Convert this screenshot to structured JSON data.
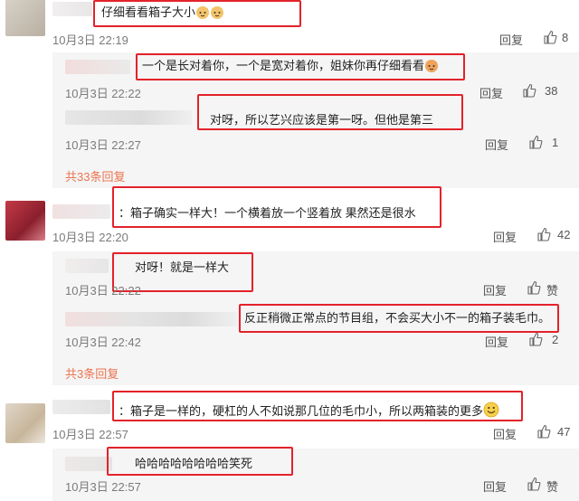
{
  "comments": [
    {
      "text": "仔细看看箱子大小",
      "time": "10月3日 22:19",
      "reply": "回复",
      "likes": "8",
      "emoji": "cat-emoji-pair"
    },
    {
      "text": "一个是长对着你，一个是宽对着你，姐妹你再仔细看看",
      "time": "10月3日 22:22",
      "reply": "回复",
      "likes": "38",
      "emoji": "cat-emoji"
    },
    {
      "text": "对呀，所以艺兴应该是第一呀。但他是第三",
      "time": "10月3日 22:27",
      "reply": "回复",
      "likes": "1"
    },
    {
      "text": "：箱子确实一样大！一个横着放一个竖着放 果然还是很水",
      "time": "10月3日 22:20",
      "reply": "回复",
      "likes": "42"
    },
    {
      "text": "对呀！就是一样大",
      "time": "10月3日 22:22",
      "reply": "回复",
      "likes": "赞"
    },
    {
      "text": "反正稍微正常点的节目组，不会买大小不一的箱子装毛巾。",
      "time": "10月3日 22:42",
      "reply": "回复",
      "likes": "2"
    },
    {
      "text": "：箱子是一样的，硬杠的人不如说那几位的毛巾小，所以两箱装的更多",
      "time": "10月3日 22:57",
      "reply": "回复",
      "likes": "47",
      "emoji": "smile-emoji"
    },
    {
      "text": "哈哈哈哈哈哈哈哈笑死",
      "time": "10月3日 22:57",
      "reply": "回复",
      "likes": "赞"
    }
  ],
  "more_replies": [
    "共33条回复",
    "共3条回复"
  ],
  "colors": {
    "accent": "#eb7350",
    "highlight": "#e3222a"
  }
}
